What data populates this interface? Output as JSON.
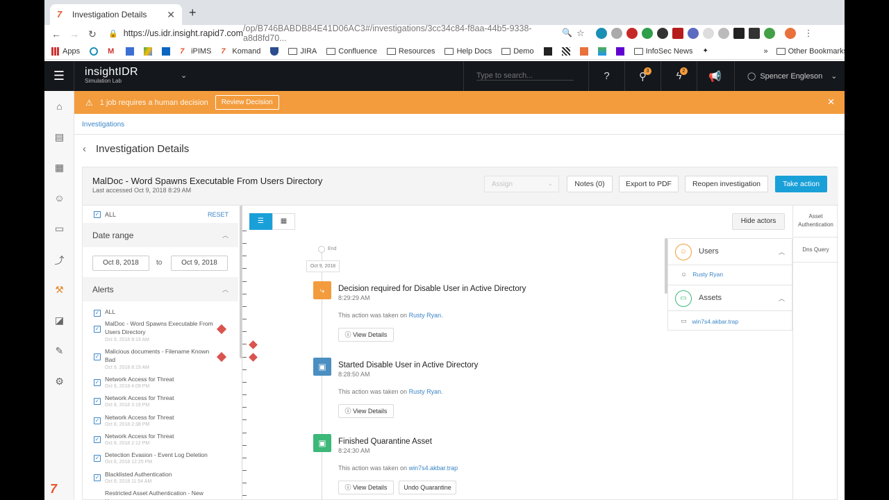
{
  "browser": {
    "tab_title": "Investigation Details",
    "url_host": "https://us.idr.insight.rapid7.com",
    "url_path": "/op/B746BABDB84E41D06AC3#/investigations/3cc34c84-f8aa-44b5-9338-a8d8fd70...",
    "bookmarks": [
      "Apps",
      "iPIMS",
      "Komand",
      "JIRA",
      "Confluence",
      "Resources",
      "Help Docs",
      "Demo",
      "InfoSec News"
    ],
    "other_bookmarks": "Other Bookmarks",
    "more": "»"
  },
  "app": {
    "name": "insightIDR",
    "subtitle": "Simulation Lab",
    "search_placeholder": "Type to search...",
    "badge_1": "3",
    "badge_2": "2",
    "user": "Spencer Engleson"
  },
  "banner": {
    "text": "1 job requires a human decision",
    "button": "Review Decision",
    "color": "#f39c3d"
  },
  "breadcrumb": "Investigations",
  "page_title": "Investigation Details",
  "investigation": {
    "title": "MalDoc - Word Spawns Executable From Users Directory",
    "last_accessed": "Last accessed Oct 9, 2018 8:29 AM",
    "assign_placeholder": "Assign",
    "notes": "Notes (0)",
    "export": "Export to PDF",
    "reopen": "Reopen investigation",
    "take_action": "Take action"
  },
  "filters": {
    "all": "ALL",
    "reset": "RESET",
    "date_range": "Date range",
    "date_from": "Oct 8, 2018",
    "to": "to",
    "date_to": "Oct 9, 2018",
    "alerts": "Alerts",
    "alerts_all": "ALL",
    "alert_items": [
      {
        "name": "MalDoc - Word Spawns Executable From Users Directory",
        "date": "Oct 9, 2018 8:19 AM"
      },
      {
        "name": "Malicious documents - Filename Known Bad",
        "date": "Oct 9, 2018 8:19 AM"
      },
      {
        "name": "Network Access for Threat",
        "date": "Oct 8, 2018 4:09 PM"
      },
      {
        "name": "Network Access for Threat",
        "date": "Oct 8, 2018 3:19 PM"
      },
      {
        "name": "Network Access for Threat",
        "date": "Oct 8, 2018 2:38 PM"
      },
      {
        "name": "Network Access for Threat",
        "date": "Oct 8, 2018 2:12 PM"
      },
      {
        "name": "Detection Evasion - Event Log Deletion",
        "date": "Oct 8, 2018 12:25 PM"
      },
      {
        "name": "Blacklisted Authentication",
        "date": "Oct 8, 2018 11:54 AM"
      },
      {
        "name": "Restricted Asset Authentication - New User",
        "date": ""
      }
    ]
  },
  "timeline": {
    "end_label": "End",
    "date_pill": "Oct 9, 2018",
    "events": [
      {
        "title": "Decision required for Disable User in Active Directory",
        "time": "8:29:29 AM",
        "text": "This action was taken on",
        "target": "Rusty Ryan.",
        "btn": "View Details",
        "color": "#f39c3d"
      },
      {
        "title": "Started Disable User in Active Directory",
        "time": "8:28:50 AM",
        "text": "This action was taken on",
        "target": "Rusty Ryan.",
        "btn": "View Details",
        "color": "#4a8ec2"
      },
      {
        "title": "Finished Quarantine Asset",
        "time": "8:24:30 AM",
        "text": "This action was taken on",
        "target": "win7s4.akbar.trap",
        "btn": "View Details",
        "btn2": "Undo Quarantine",
        "color": "#3cb878"
      }
    ]
  },
  "actors": {
    "hide": "Hide actors",
    "users_label": "Users",
    "user_item": "Rusty Ryan",
    "assets_label": "Assets",
    "asset_item": "win7s4.akbar.trap"
  },
  "right_tabs": [
    "Asset Authentication",
    "Dns Query"
  ]
}
